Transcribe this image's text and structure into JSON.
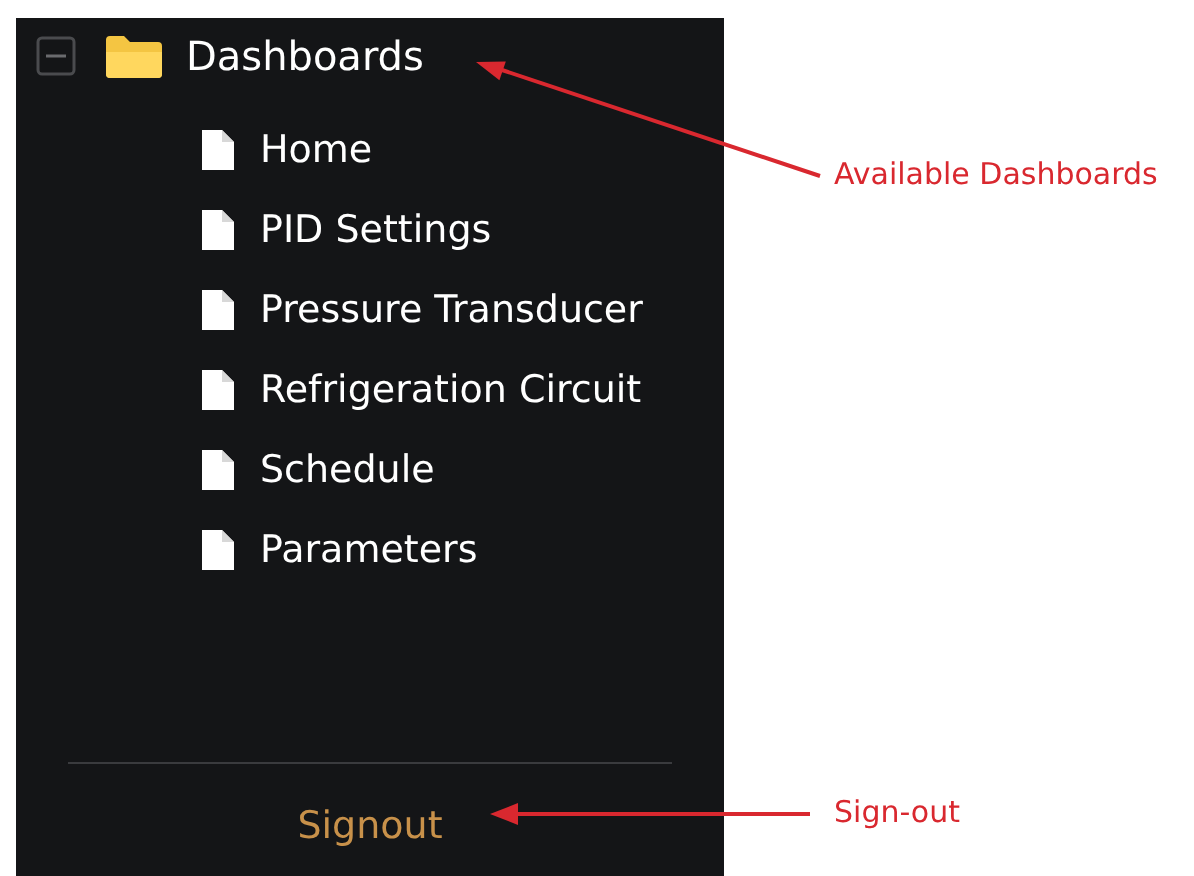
{
  "tree": {
    "label": "Dashboards",
    "expanded": true,
    "children": [
      {
        "label": "Home"
      },
      {
        "label": "PID Settings"
      },
      {
        "label": "Pressure Transducer"
      },
      {
        "label": "Refrigeration Circuit"
      },
      {
        "label": "Schedule"
      },
      {
        "label": "Parameters"
      }
    ]
  },
  "signout": "Signout",
  "annotations": [
    {
      "label": "Available Dashboards"
    },
    {
      "label": "Sign-out"
    }
  ]
}
